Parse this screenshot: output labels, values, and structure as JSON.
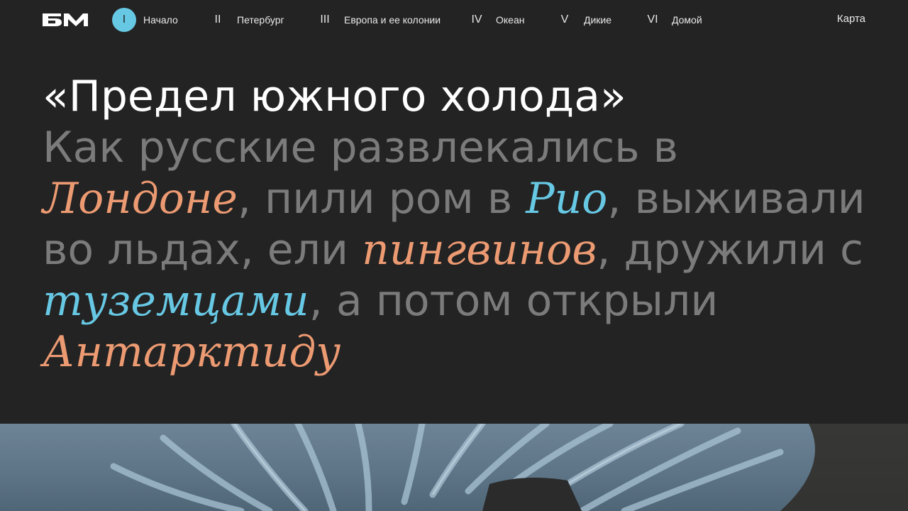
{
  "header": {
    "logo_label": "БМ",
    "nav": [
      {
        "num": "I",
        "label": "Начало",
        "active": true
      },
      {
        "num": "II",
        "label": "Петербург",
        "active": false
      },
      {
        "num": "III",
        "label": "Европа и ее колонии",
        "active": false
      },
      {
        "num": "IV",
        "label": "Океан",
        "active": false
      },
      {
        "num": "V",
        "label": "Дикие",
        "active": false
      },
      {
        "num": "VI",
        "label": "Домой",
        "active": false
      }
    ],
    "map_label": "Карта"
  },
  "hero": {
    "title": "«Предел южного холода»",
    "sub_1": "Как русские развлекались в ",
    "hl_london": "Лондоне",
    "sub_2": ", пили ром в ",
    "hl_rio": "Рио",
    "sub_3": ", выживали во льдах, ели ",
    "hl_penguins": "пингвинов",
    "sub_4": ", дружили с ",
    "hl_natives": "туземцами",
    "sub_5": ", а потом открыли ",
    "hl_antarctica": "Антарктиду"
  },
  "colors": {
    "background": "#232323",
    "accent_cyan": "#67c8e4",
    "accent_orange": "#ec9a72",
    "subtitle_gray": "#7b7b7b"
  },
  "icons": {
    "logo": "bm-logo-icon"
  }
}
